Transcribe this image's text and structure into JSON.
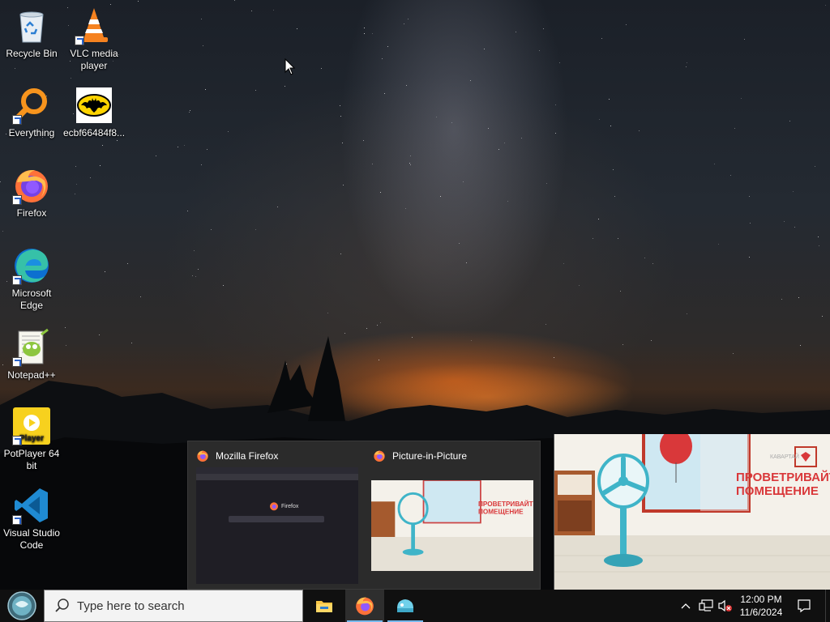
{
  "desktop": {
    "icons": [
      {
        "label": "Recycle Bin",
        "icon": "recycle-bin-icon"
      },
      {
        "label": "VLC media player",
        "icon": "vlc-icon"
      },
      {
        "label": "Everything",
        "icon": "everything-icon"
      },
      {
        "label": "ecbf66484f8...",
        "icon": "batman-image-icon"
      },
      {
        "label": "Firefox",
        "icon": "firefox-icon"
      },
      {
        "label": "Microsoft Edge",
        "icon": "edge-icon"
      },
      {
        "label": "Notepad++",
        "icon": "notepadpp-icon"
      },
      {
        "label": "PotPlayer 64 bit",
        "icon": "potplayer-icon"
      },
      {
        "label": "Visual Studio Code",
        "icon": "vscode-icon"
      }
    ],
    "potplayer_badge": "Player"
  },
  "thumbnails": [
    {
      "title": "Mozilla Firefox",
      "preview_logo_text": "Firefox"
    },
    {
      "title": "Picture-in-Picture"
    }
  ],
  "video": {
    "caption_line1": "ПРОВЕТРИВАЙТЕ",
    "caption_line2": "ПОМЕЩЕНИЕ",
    "watermark": "КАВАРТАЙ"
  },
  "taskbar": {
    "search_placeholder": "Type here to search",
    "apps": [
      "file-explorer-icon",
      "firefox-icon",
      "app-icon"
    ],
    "clock_time": "12:00 PM",
    "clock_date": "11/6/2024"
  },
  "colors": {
    "taskbar_bg": "#101010",
    "accent": "#76b9ed",
    "thumb_bg": "#2b2b2b",
    "caption_red": "#d9383a",
    "fan_blue": "#3fb4c8"
  }
}
